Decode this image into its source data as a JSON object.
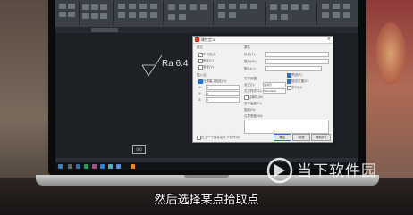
{
  "drawing": {
    "annotation": "Ra 6.4",
    "point_label": "0.0"
  },
  "dialog": {
    "title": "属性定义",
    "sections": {
      "mode": "模式",
      "attribute": "属性",
      "insert_point": "插入点",
      "text_settings": "文字设置"
    },
    "attribute_fields": {
      "tag": "标记(T):",
      "prompt": "提示(M):",
      "default": "默认(L):"
    },
    "mode_options": [
      "不可见(I)",
      "固定(C)",
      "验证(V)",
      "预设(P)",
      "锁定位置(K)",
      "多行(U)"
    ],
    "insert_point": {
      "specify_on_screen": "在屏幕上指定(O)",
      "x": "X:",
      "y": "Y:",
      "z": "Z:",
      "x_value": "0",
      "y_value": "0",
      "z_value": "0"
    },
    "text_settings": {
      "justification": "对正(J):",
      "justification_value": "左对齐",
      "text_style": "文字样式(S):",
      "text_style_value": "Standard",
      "annotative": "注释性(N)",
      "text_height": "文字高度(E):",
      "rotation": "旋转(R):",
      "boundary_width": "边界宽度(W):"
    },
    "align_below": "在上一个属性定义下对齐(A)",
    "buttons": {
      "ok": "确定",
      "cancel": "取消",
      "help": "帮助(H)"
    }
  },
  "watermark": {
    "text": "当下软件园"
  },
  "subtitle": "然后选择某点拾取点",
  "colors": {
    "dialog_accent": "#2e6fd1",
    "autocad_red": "#d43b2f",
    "screen_bg": "#1d2126"
  }
}
